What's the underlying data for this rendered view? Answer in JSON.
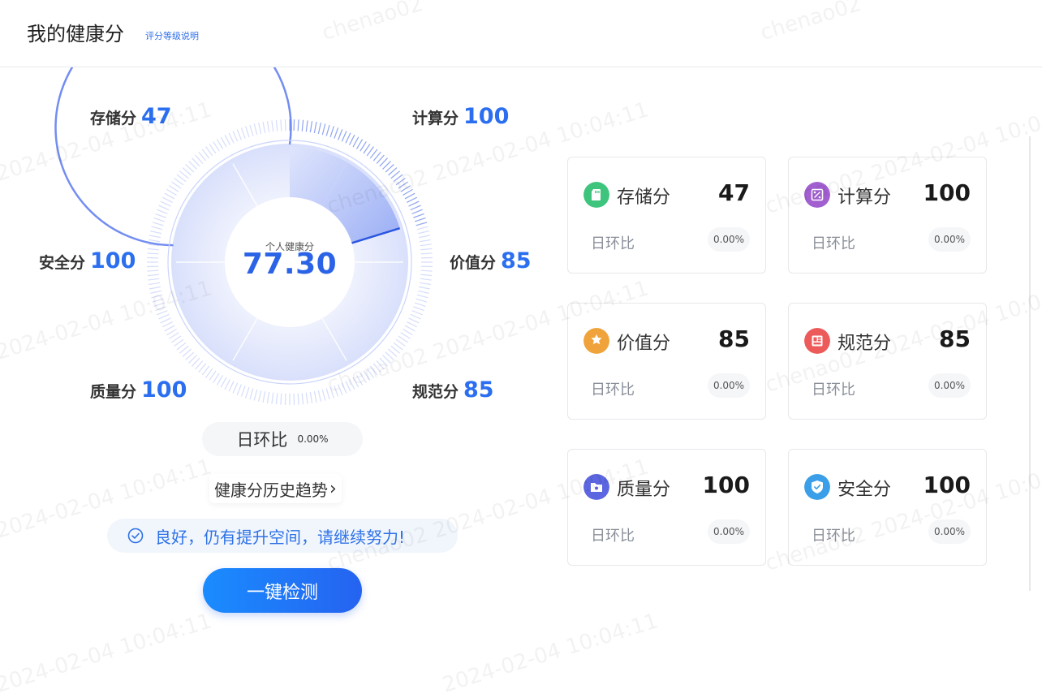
{
  "header": {
    "title": "我的健康分",
    "explain_link": "评分等级说明"
  },
  "radar": {
    "labels": [
      {
        "name": "存储分",
        "value": "47"
      },
      {
        "name": "计算分",
        "value": "100"
      },
      {
        "name": "价值分",
        "value": "85"
      },
      {
        "name": "规范分",
        "value": "85"
      },
      {
        "name": "质量分",
        "value": "100"
      },
      {
        "name": "安全分",
        "value": "100"
      }
    ],
    "center_caption": "个人健康分",
    "center_value": "77.30",
    "progress_fraction": 0.773,
    "accent_color": "#2b6ff0"
  },
  "chart_data": {
    "type": "radial",
    "categories": [
      "存储分",
      "计算分",
      "价值分",
      "规范分",
      "质量分",
      "安全分"
    ],
    "values": [
      47,
      100,
      85,
      85,
      100,
      100
    ],
    "ylim": [
      0,
      100
    ],
    "total": 77.3
  },
  "daily": {
    "label": "日环比",
    "pct": "0.00%"
  },
  "history_link": "健康分历史趋势",
  "status_text": "良好，仍有提升空间，请继续努力!",
  "primary_button": "一键检测",
  "cards": [
    {
      "name": "存储分",
      "value": "47",
      "daily_label": "日环比",
      "daily_pct": "0.00%",
      "icon": "sd-card-icon",
      "color": "#3ec47c"
    },
    {
      "name": "计算分",
      "value": "100",
      "daily_label": "日环比",
      "daily_pct": "0.00%",
      "icon": "percent-icon",
      "color": "#a25fd0"
    },
    {
      "name": "价值分",
      "value": "85",
      "daily_label": "日环比",
      "daily_pct": "0.00%",
      "icon": "badge-star-icon",
      "color": "#efa33a"
    },
    {
      "name": "规范分",
      "value": "85",
      "daily_label": "日环比",
      "daily_pct": "0.00%",
      "icon": "grid-doc-icon",
      "color": "#ec5a5a"
    },
    {
      "name": "质量分",
      "value": "100",
      "daily_label": "日环比",
      "daily_pct": "0.00%",
      "icon": "folder-icon",
      "color": "#5b66e0"
    },
    {
      "name": "安全分",
      "value": "100",
      "daily_label": "日环比",
      "daily_pct": "0.00%",
      "icon": "shield-check-icon",
      "color": "#3a9ee8"
    }
  ],
  "watermark": {
    "user": "chenao02",
    "time": "2024-02-04 10:04:11"
  }
}
